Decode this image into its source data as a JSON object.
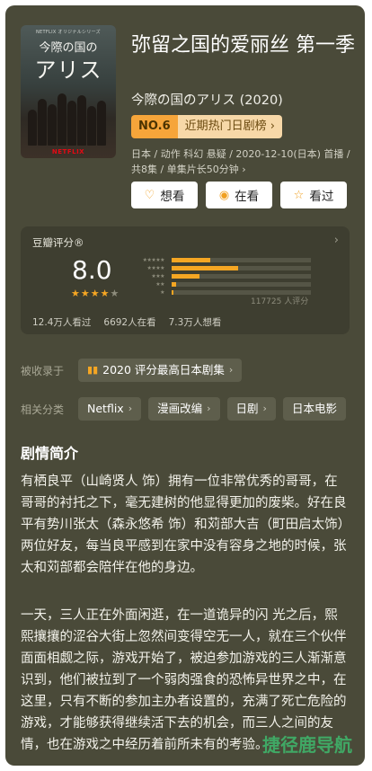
{
  "poster": {
    "top_text": "NETFLIX オリジナルシリーズ",
    "title_line1": "今際の国の",
    "title_line2": "アリス",
    "brand": "NETFLIX"
  },
  "header": {
    "title": "弥留之国的爱丽丝 第一季",
    "original_title": "今際の国のアリス (2020)",
    "rank": "NO.6",
    "rank_label": "近期热门日剧榜 ›",
    "meta": "日本 / 动作 科幻 悬疑 / 2020-12-10(日本) 首播 / 共8集 / 单集片长50分钟 ›"
  },
  "actions": [
    {
      "icon": "heart-outline-icon",
      "label": "想看"
    },
    {
      "icon": "eye-icon",
      "label": "在看"
    },
    {
      "icon": "star-outline-icon",
      "label": "看过"
    }
  ],
  "rating": {
    "label": "豆瓣评分®",
    "score": "8.0",
    "stars": 4,
    "distribution": [
      {
        "stars": "★★★★★",
        "fraction": 0.28
      },
      {
        "stars": "★★★★",
        "fraction": 0.48
      },
      {
        "stars": "★★★",
        "fraction": 0.2
      },
      {
        "stars": "★★",
        "fraction": 0.03
      },
      {
        "stars": "★",
        "fraction": 0.01
      }
    ],
    "total": "117725 人评分",
    "stats": [
      "12.4万人看过",
      "6692人在看",
      "7.3万人想看"
    ]
  },
  "collections": {
    "label": "被收录于",
    "items": [
      {
        "text": "2020 评分最高日本剧集"
      }
    ]
  },
  "categories": {
    "label": "相关分类",
    "items": [
      "Netflix",
      "漫画改编",
      "日剧",
      "日本电影"
    ]
  },
  "synopsis": {
    "title": "剧情简介",
    "para1": "有栖良平（山崎贤人 饰）拥有一位非常优秀的哥哥，在哥哥的衬托之下，毫无建树的他显得更加的废柴。好在良平有势川张太（森永悠希 饰）和苅部大吉（町田启太饰）两位好友，每当良平感到在家中没有容身之地的时候，张太和苅部都会陪伴在他的身边。",
    "para2": "一天，三人正在外面闲逛，在一道诡异的闪 光之后，熙熙攘攘的涩谷大街上忽然间变得空无一人，就在三个伙伴面面相觑之际，游戏开始了，被迫参加游戏的三人渐渐意识到，他们被拉到了一个弱肉强食的恐怖异世界之中，在这里，只有不断的参加主办者设置的，充满了死亡危险的游戏，才能够获得继续活下去的机会，而三人之间的友情，也在游戏之中经历着前所未有的考验。"
  },
  "watermark": "捷径鹿导航",
  "colors": {
    "background": "#4a4a39",
    "accent": "#f5a623",
    "card": "#3e3e30"
  }
}
